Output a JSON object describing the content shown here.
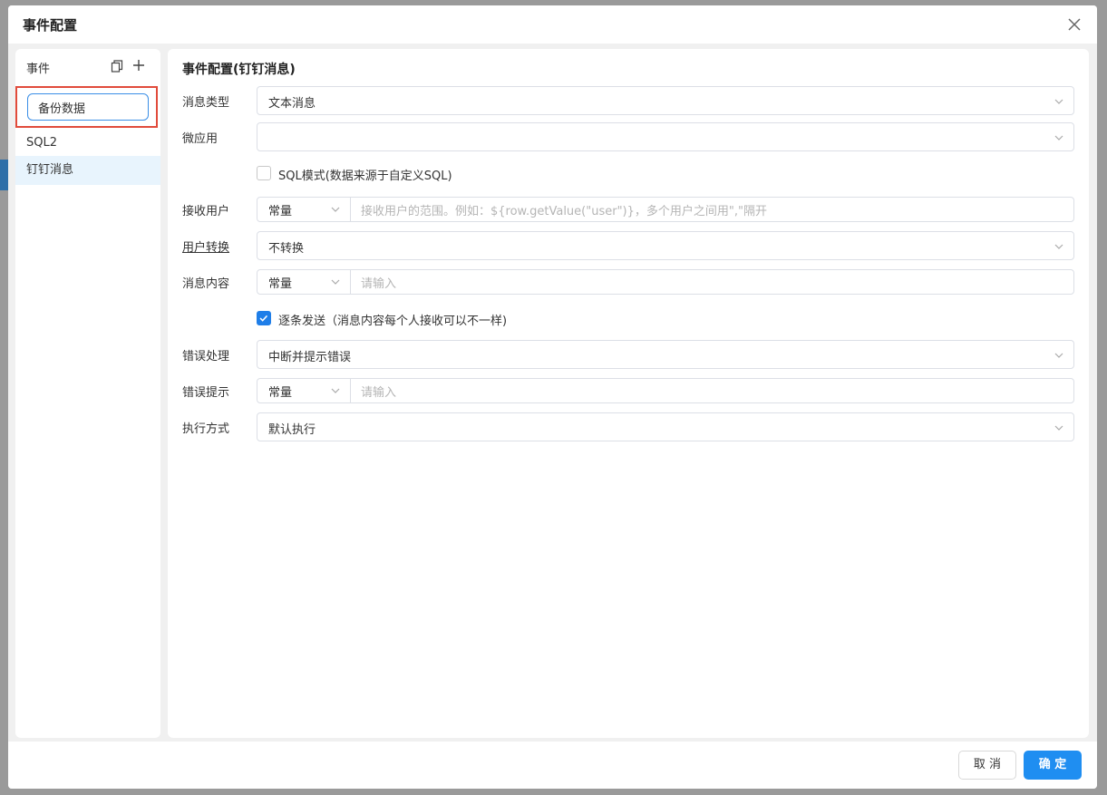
{
  "dialog": {
    "title": "事件配置"
  },
  "events_panel": {
    "title": "事件",
    "editing_value": "备份数据",
    "items": [
      {
        "label": "SQL2"
      },
      {
        "label": "钉钉消息"
      }
    ]
  },
  "config": {
    "title": "事件配置(钉钉消息)",
    "msg_type": {
      "label": "消息类型",
      "value": "文本消息"
    },
    "micro_app": {
      "label": "微应用",
      "value": ""
    },
    "sql_mode": {
      "label": "SQL模式(数据来源于自定义SQL)",
      "checked": false
    },
    "receiver": {
      "label": "接收用户",
      "mode": "常量",
      "placeholder": "接收用户的范围。例如：${row.getValue(\"user\")}，多个用户之间用\",\"隔开"
    },
    "user_convert": {
      "label": "用户转换",
      "value": "不转换"
    },
    "content": {
      "label": "消息内容",
      "mode": "常量",
      "placeholder": "请输入"
    },
    "send_each": {
      "label": "逐条发送（消息内容每个人接收可以不一样)",
      "checked": true
    },
    "error_handle": {
      "label": "错误处理",
      "value": "中断并提示错误"
    },
    "error_tip": {
      "label": "错误提示",
      "mode": "常量",
      "placeholder": "请输入"
    },
    "exec_mode": {
      "label": "执行方式",
      "value": "默认执行"
    }
  },
  "footer": {
    "cancel_label": "取 消",
    "ok_label": "确 定"
  },
  "colors": {
    "primary": "#1f8ef1",
    "highlight_border": "#e14b3b",
    "active_item": "#e8f4fd"
  }
}
